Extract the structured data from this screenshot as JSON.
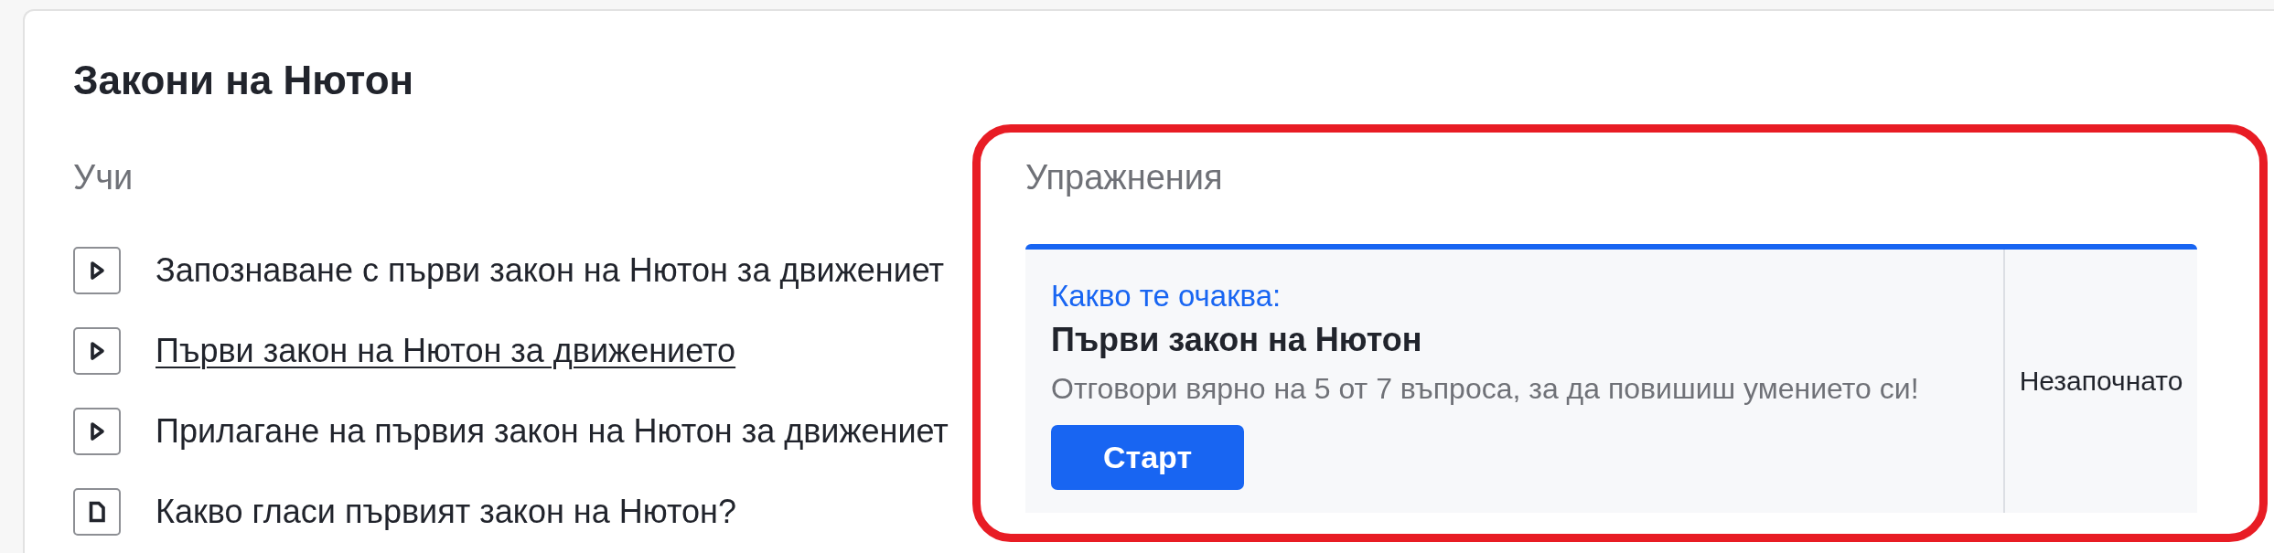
{
  "lesson": {
    "title": "Закони на Нютон"
  },
  "learn": {
    "heading": "Учи",
    "items": [
      {
        "kind": "video",
        "label": "Запознаване с първи закон на Нютон за движениет",
        "hovered": false
      },
      {
        "kind": "video",
        "label": "Първи закон на Нютон за движението",
        "hovered": true
      },
      {
        "kind": "video",
        "label": "Прилагане на първия закон на Нютон за движениет",
        "hovered": false
      },
      {
        "kind": "article",
        "label": "Какво гласи първият закон на Нютон?",
        "hovered": false
      }
    ]
  },
  "practice": {
    "heading": "Упражнения",
    "highlighted": true,
    "exercise": {
      "eyebrow": "Какво те очаква:",
      "title": "Първи закон на Нютон",
      "description": "Отговори вярно на 5 от 7 въпроса, за да повишиш умението си!",
      "button": "Старт",
      "status": "Незапочнато"
    }
  }
}
